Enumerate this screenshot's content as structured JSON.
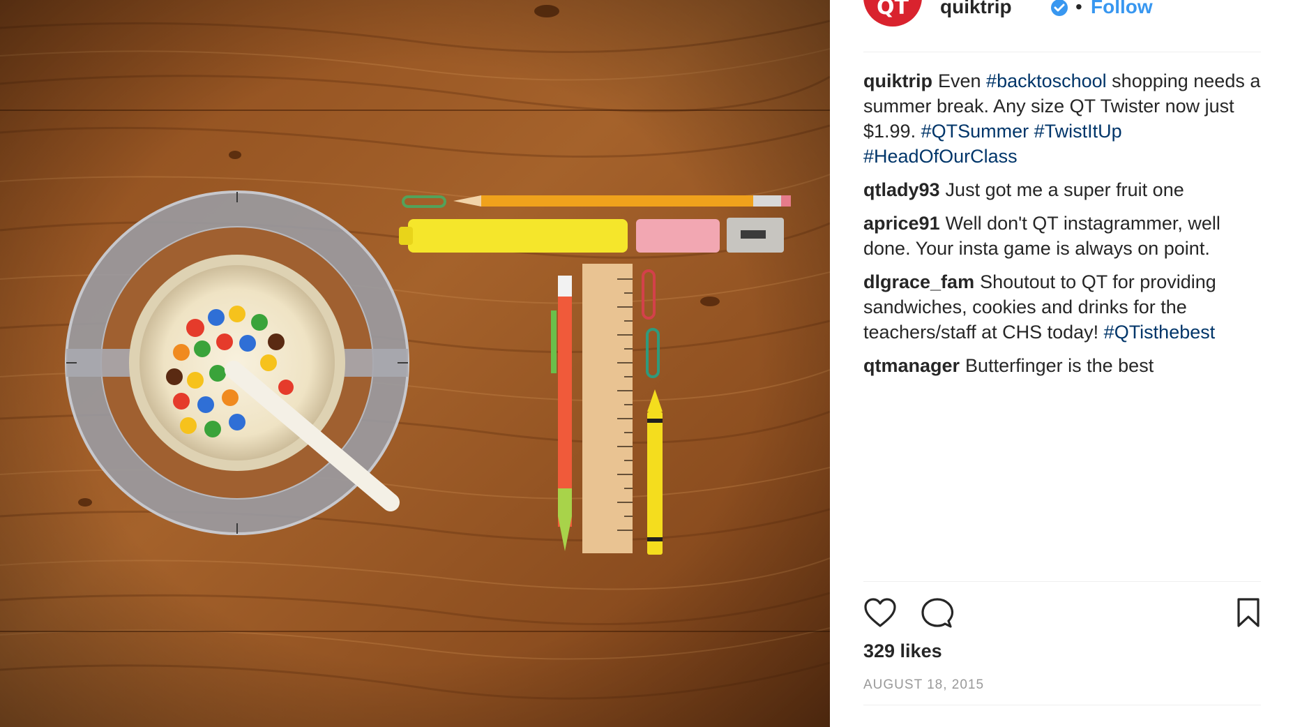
{
  "post": {
    "username": "quiktrip",
    "follow_label": "Follow",
    "separator": "•",
    "avatar_text": "QT",
    "verified": true
  },
  "caption": {
    "username": "quiktrip",
    "text_1": "Even ",
    "tag_1": "#backtoschool",
    "text_2": " shopping needs a summer break. Any size QT Twister now just $1.99. ",
    "tag_2": "#QTSummer",
    "text_3": " ",
    "tag_3": "#TwistItUp",
    "text_4": " ",
    "tag_4": "#HeadOfOurClass"
  },
  "comments": [
    {
      "username": "qtlady93",
      "text": "Just got me a super fruit one"
    },
    {
      "username": "aprice91",
      "text": "Well don't QT instagrammer, well done. Your insta game is always on point."
    },
    {
      "username": "dlgrace_fam",
      "text": "Shoutout to QT for providing sandwiches, cookies and drinks for the teachers/staff at CHS today! ",
      "tag": "#QTisthebest"
    },
    {
      "username": "qtmanager",
      "text": "Butterfinger is the best"
    }
  ],
  "likes": "329 likes",
  "date": "AUGUST 18, 2015",
  "icons": {
    "like": "heart-icon",
    "comment": "comment-icon",
    "save": "bookmark-icon",
    "verified": "verified-badge-icon"
  },
  "colors": {
    "link": "#003569",
    "follow": "#3897f0",
    "brand": "#d9232e",
    "meta": "#999999"
  }
}
